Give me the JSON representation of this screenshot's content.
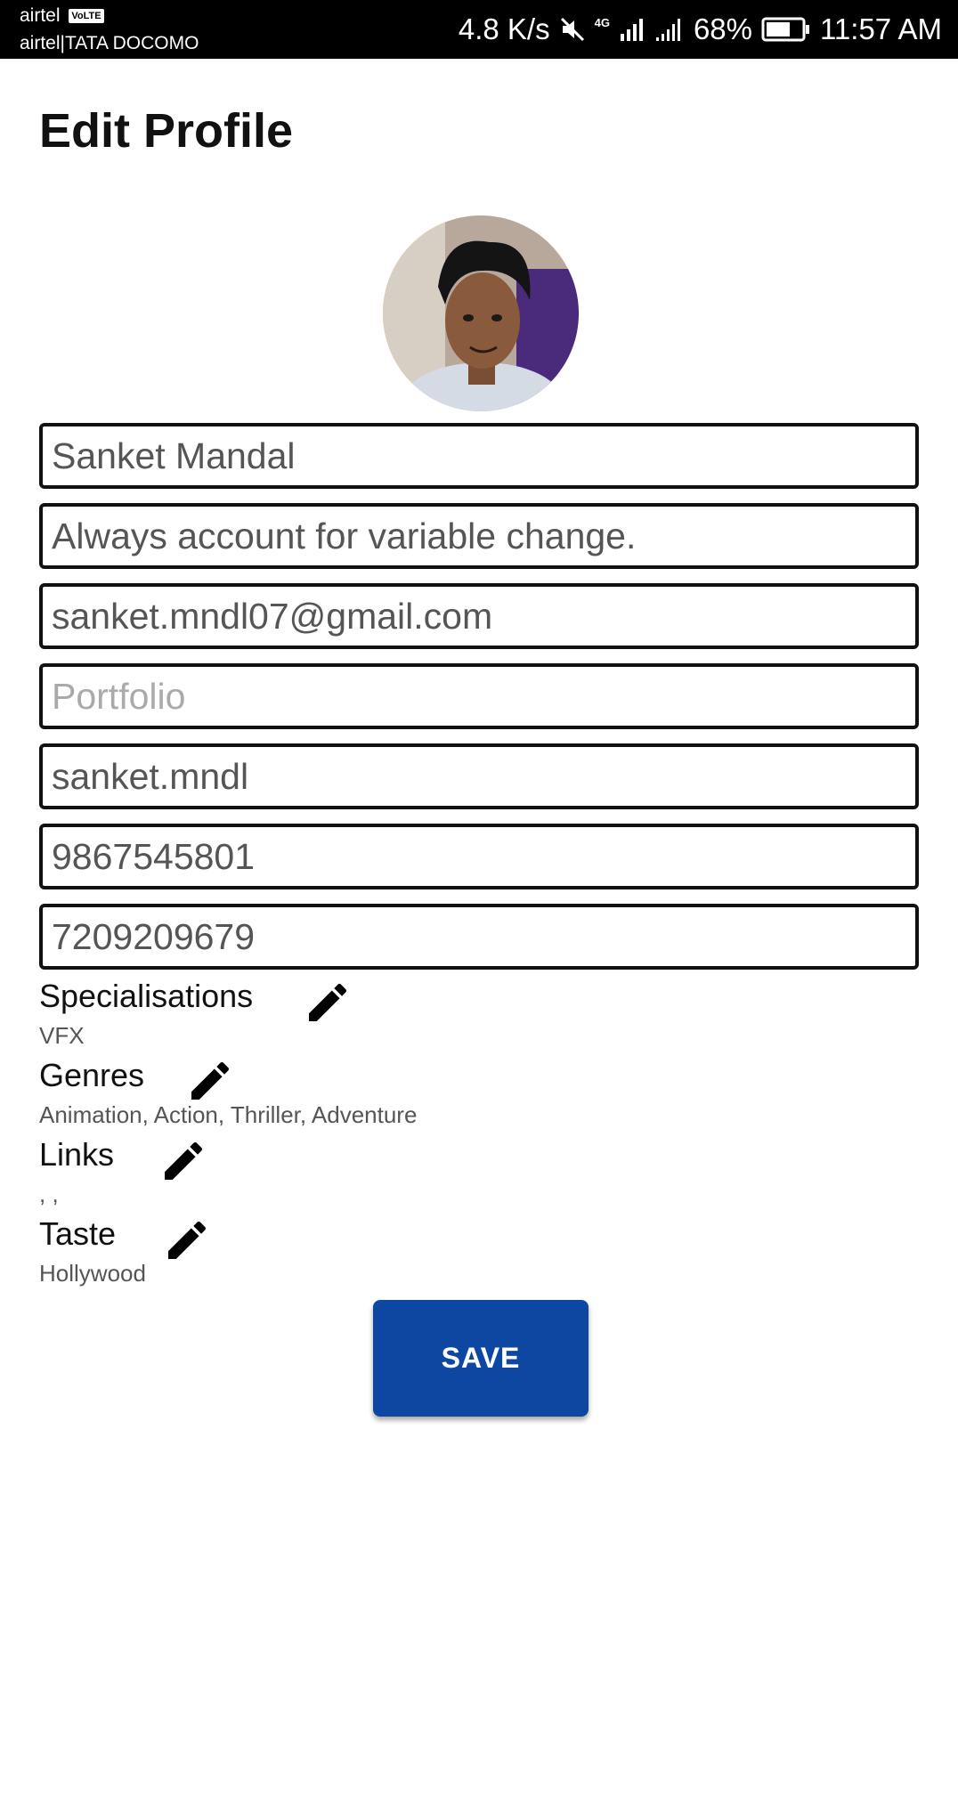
{
  "status_bar": {
    "carrier_primary": "airtel",
    "volte_badge": "VoLTE",
    "carrier_secondary": "airtel|TATA DOCOMO",
    "network_speed": "4.8 K/s",
    "network_type": "4G",
    "battery": "68%",
    "time": "11:57 AM"
  },
  "header": {
    "title": "Edit Profile"
  },
  "form": {
    "name": {
      "value": "Sanket Mandal"
    },
    "bio": {
      "value": "Always account for variable change."
    },
    "email": {
      "value": "sanket.mndl07@gmail.com"
    },
    "portfolio": {
      "value": "",
      "placeholder": "Portfolio"
    },
    "username": {
      "value": "sanket.mndl"
    },
    "phone_primary": {
      "value": "9867545801"
    },
    "phone_secondary": {
      "value": "7209209679"
    }
  },
  "sections": {
    "specialisations": {
      "label": "Specialisations",
      "value": "VFX"
    },
    "genres": {
      "label": "Genres",
      "value": "Animation, Action, Thriller, Adventure"
    },
    "links": {
      "label": "Links",
      "value": ", ,"
    },
    "taste": {
      "label": "Taste",
      "value": "Hollywood"
    }
  },
  "actions": {
    "save_label": "SAVE"
  },
  "colors": {
    "primary_button": "#0d47a1"
  }
}
